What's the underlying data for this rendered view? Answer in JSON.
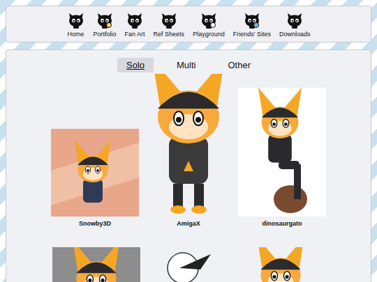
{
  "nav": {
    "items": [
      {
        "label": "Home"
      },
      {
        "label": "Portfolio"
      },
      {
        "label": "Fan Art"
      },
      {
        "label": "Ref Sheets"
      },
      {
        "label": "Playground"
      },
      {
        "label": "Friends' Sites"
      },
      {
        "label": "Downloads"
      }
    ]
  },
  "tabs": [
    {
      "label": "Solo",
      "selected": true
    },
    {
      "label": "Multi",
      "selected": false
    },
    {
      "label": "Other",
      "selected": false
    }
  ],
  "gallery": {
    "items": [
      {
        "caption": "Snowby3D"
      },
      {
        "caption": "AmigaX"
      },
      {
        "caption": "dinosaurgato"
      }
    ]
  }
}
